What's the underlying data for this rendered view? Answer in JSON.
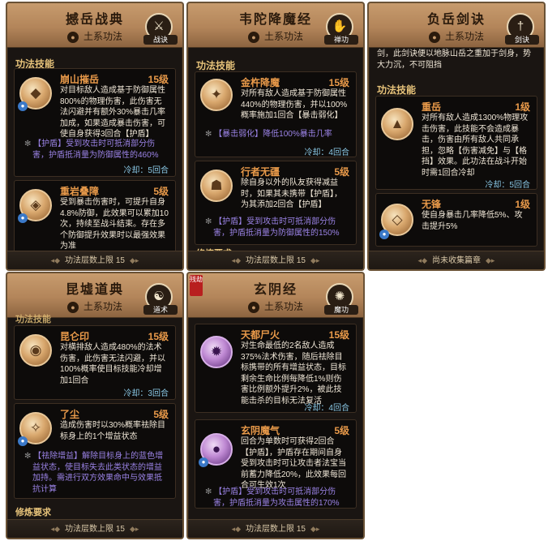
{
  "shared": {
    "element": "土系功法"
  },
  "panels": {
    "p1": {
      "title": "撼岳战典",
      "badge": "战诀",
      "section": "功法技能",
      "skills": [
        {
          "name": "崩山摧岳",
          "level": "15级",
          "desc": "对目标敌人造成基于防御属性800%的物理伤害，此伤害无法闪避并有额外30%暴击几率加成，如果造成暴击伤害，可使自身获得3回合【护盾】",
          "note": "【护盾】受到攻击时可抵消部分伤害，护盾抵消量为防御属性的460%",
          "cooldown": "冷却：5回合"
        },
        {
          "name": "重岩叠障",
          "level": "5级",
          "desc": "受到暴击伤害时，可提升自身4.8%防御，此效果可以累加10次，持续至战斗结束。存在多个防御提升效果时以最强效果为准"
        }
      ],
      "footer": "功法层数上限 15"
    },
    "p2": {
      "title": "韦陀降魔经",
      "badge": "禅功",
      "section": "功法技能",
      "skills": [
        {
          "name": "金杵降魔",
          "level": "15级",
          "desc": "对所有敌人造成基于防御属性440%的物理伤害，并以100%概率施加1回合【暴击弱化】",
          "note": "【暴击弱化】降低100%暴击几率",
          "cooldown": "冷却：4回合"
        },
        {
          "name": "行者无疆",
          "level": "5级",
          "desc": "除自身以外的队友获得减益时，如果其未携带【护盾】，为其添加2回合【护盾】",
          "note": "【护盾】受到攻击时可抵消部分伤害，护盾抵消量为防御属性的150%"
        }
      ],
      "partial": "修炼要求",
      "footer": "功法层数上限 15"
    },
    "p3": {
      "title": "负岳剑诀",
      "badge": "剑诀",
      "top_text": "剑，此剑诀便以地脉山岳之重加于剑身，势大力沉，不可阻挡",
      "section": "功法技能",
      "skills": [
        {
          "name": "重岳",
          "level": "1级",
          "desc": "对所有敌人造成1300%物理攻击伤害，此技能不会造成暴击，伤害由所有敌人共同承担，忽略【伤害减免】与【格挡】效果。此功法在战斗开始时需1回合冷却",
          "cooldown": "冷却：5回合"
        },
        {
          "name": "无锋",
          "level": "1级",
          "desc": "使自身暴击几率降低5%、攻击提升5%"
        }
      ],
      "footer": "尚未收集篇章"
    },
    "p4": {
      "title": "昆墟道典",
      "badge": "道术",
      "partial_top": "功法技能",
      "skills": [
        {
          "name": "昆仑印",
          "level": "15级",
          "desc": "对横排敌人造成480%的法术伤害，此伤害无法闪避，并以100%概率使目标技能冷却增加1回合",
          "cooldown": "冷却：3回合"
        },
        {
          "name": "了尘",
          "level": "5级",
          "desc": "造成伤害时以30%概率祛除目标身上的1个增益状态",
          "note": "【祛除增益】解除目标身上的蓝色增益状态，使目标失去此类状态的增益加持。需进行双方效果命中与效果抵抗计算"
        }
      ],
      "partial": "修炼要求",
      "footer": "功法层数上限 15"
    },
    "p5": {
      "title": "玄阴经",
      "badge": "魔功",
      "ribbon": "残劫",
      "skills": [
        {
          "name": "天都尸火",
          "level": "15级",
          "desc": "对生命最低的2名敌人造成375%法术伤害，随后祛除目标携带的所有增益状态，目标剩余生命比例每降低1%则伤害比例额外提升2%，被此技能击杀的目标无法复活",
          "cooldown": "冷却：4回合"
        },
        {
          "name": "玄阴魔气",
          "level": "5级",
          "desc": "回合为单数时可获得2回合【护盾】，护盾存在期间自身受到攻击时可让攻击者法宝当前蓄力降低20%，此效果每回合可生效1次",
          "note": "【护盾】受到攻击时可抵消部分伤害，护盾抵消量为攻击属性的170%"
        }
      ],
      "footer": "功法层数上限 15"
    }
  }
}
